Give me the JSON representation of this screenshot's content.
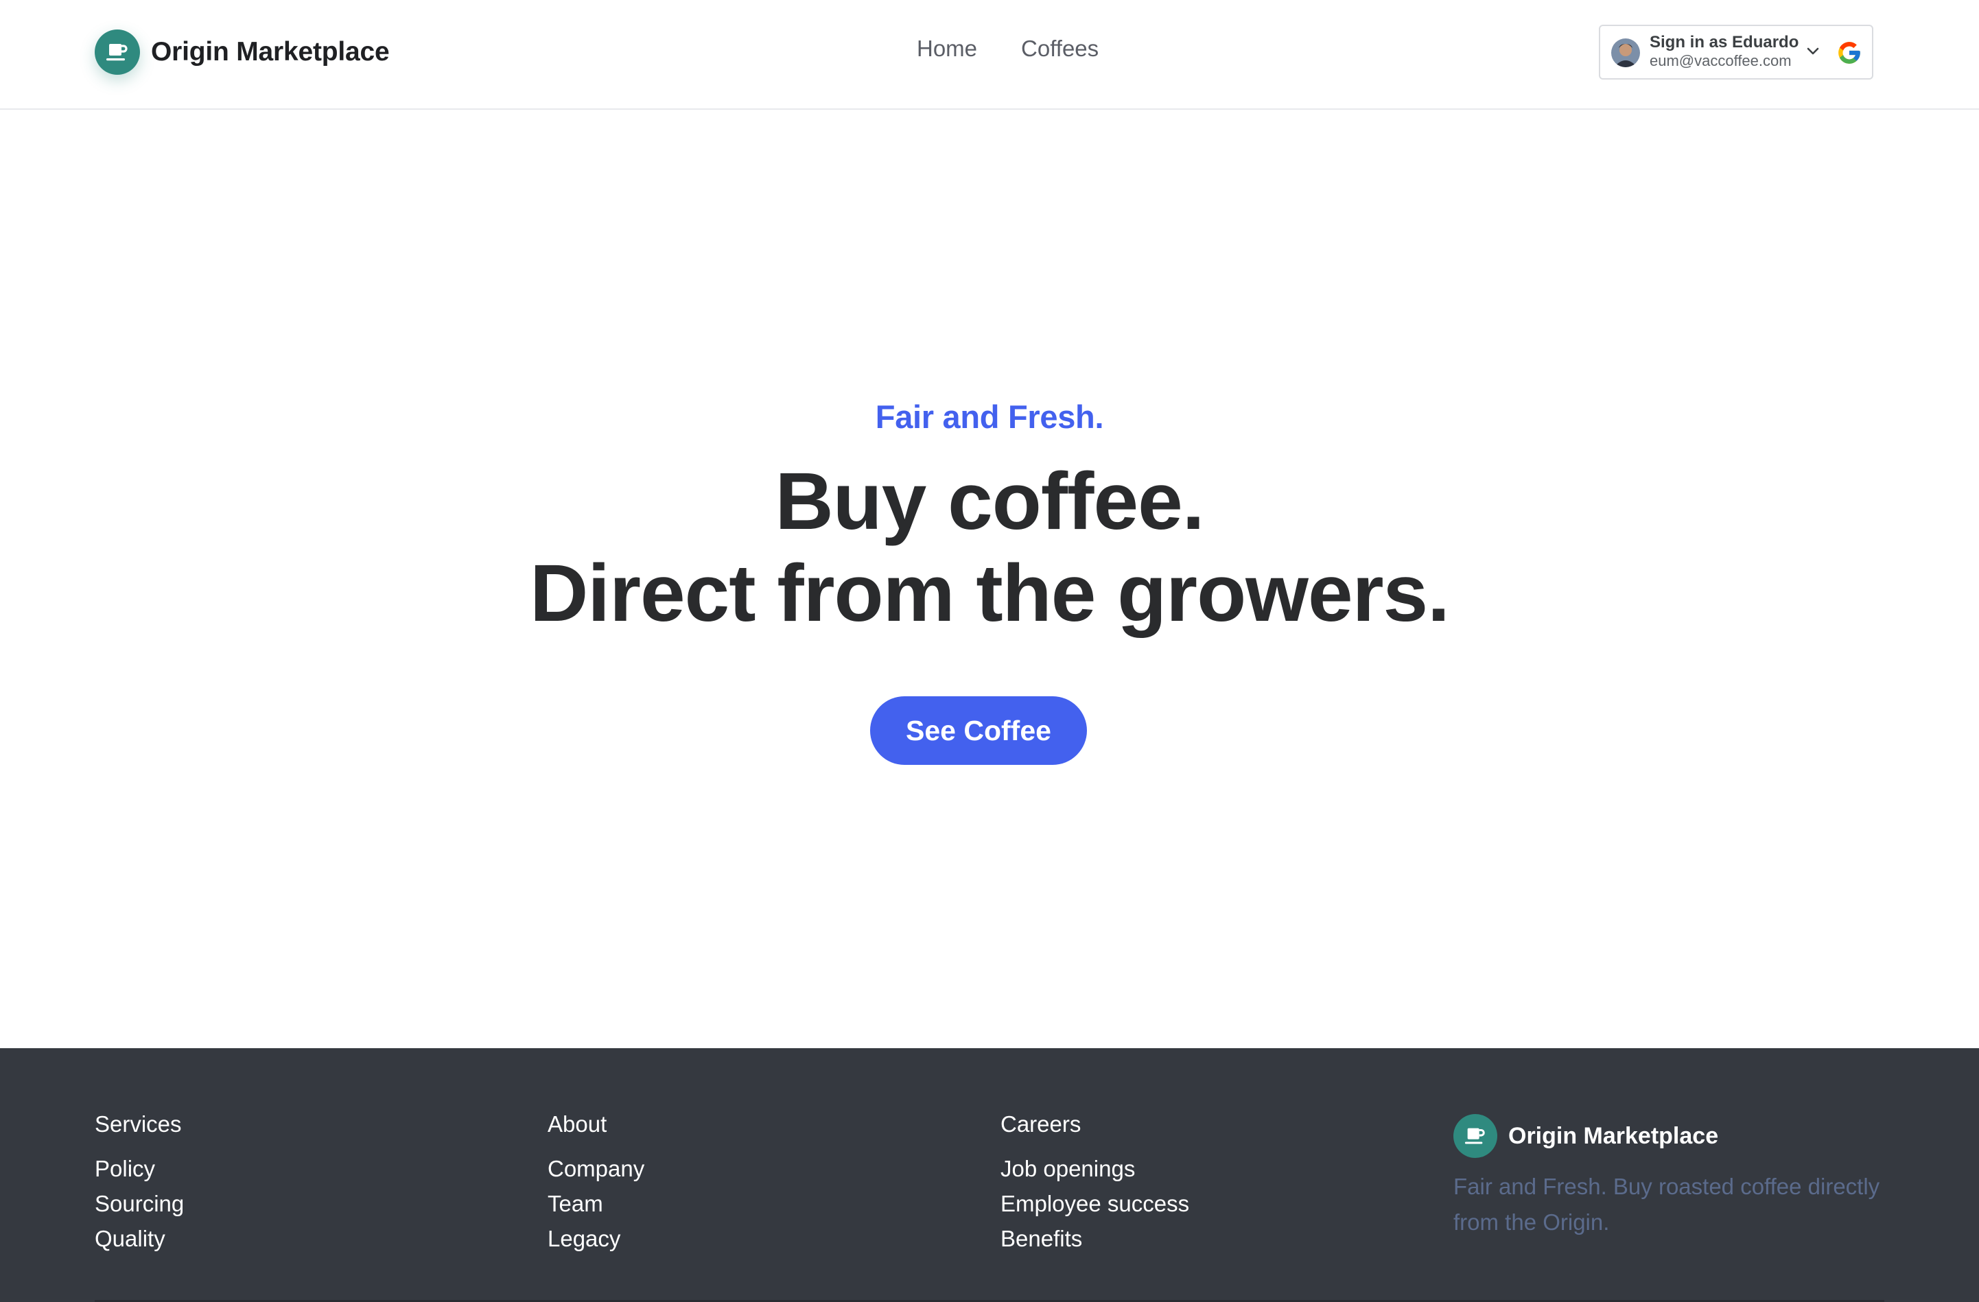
{
  "header": {
    "brand_name": "Origin Marketplace",
    "nav": [
      "Home",
      "Coffees"
    ],
    "signin": {
      "label": "Sign in as Eduardo",
      "email": "eum@vaccoffee.com"
    }
  },
  "hero": {
    "eyebrow": "Fair and Fresh.",
    "headline_line1": "Buy coffee.",
    "headline_line2": "Direct from the growers.",
    "cta_label": "See Coffee"
  },
  "footer": {
    "columns": [
      {
        "heading": "Services",
        "links": [
          "Policy",
          "Sourcing",
          "Quality"
        ]
      },
      {
        "heading": "About",
        "links": [
          "Company",
          "Team",
          "Legacy"
        ]
      },
      {
        "heading": "Careers",
        "links": [
          "Job openings",
          "Employee success",
          "Benefits"
        ]
      }
    ],
    "brand_name": "Origin Marketplace",
    "tagline": "Fair and Fresh. Buy roasted coffee directly from the Origin."
  },
  "colors": {
    "accent": "#4361ee",
    "brand_teal": "#2f8a7f",
    "footer_bg": "#353940",
    "headline": "#2a2b2d"
  },
  "icons": [
    "coffee-cup-icon",
    "avatar",
    "chevron-down-icon",
    "google-g-icon"
  ]
}
